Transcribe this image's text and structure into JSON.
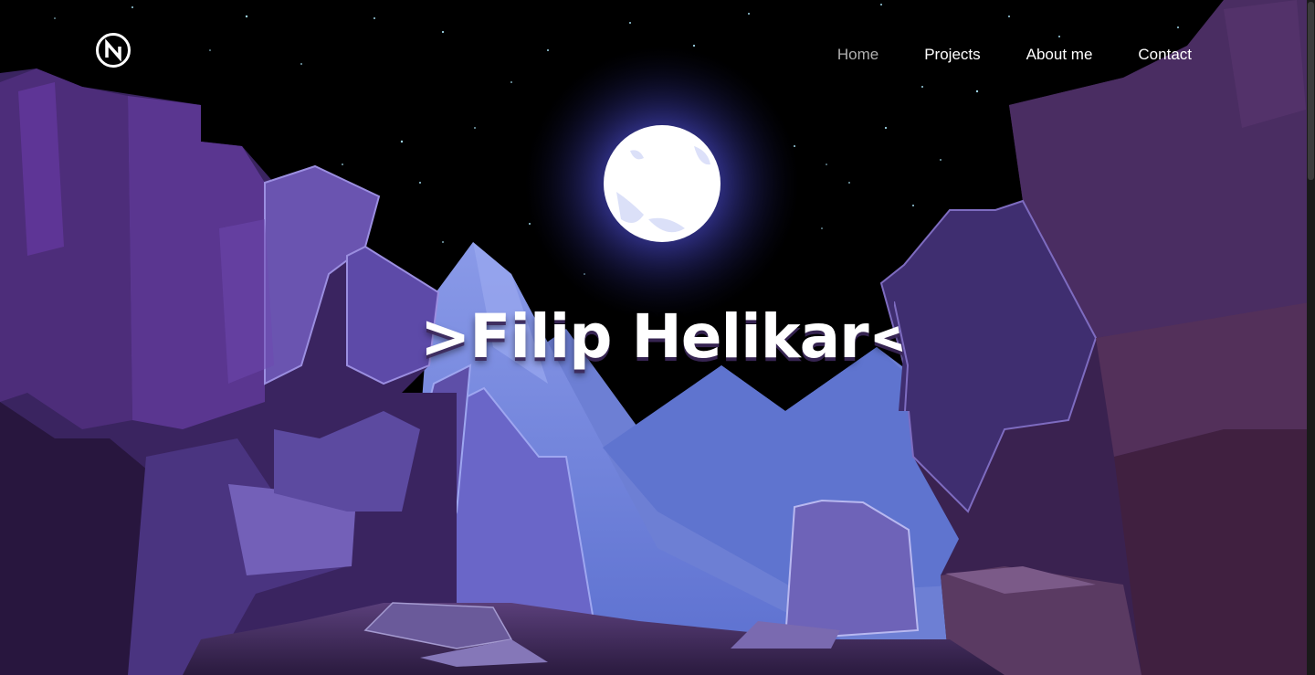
{
  "site": {
    "logo_icon": "n-logo-icon",
    "hero_title": ">Filip Helikar</:"
  },
  "nav": {
    "items": [
      {
        "label": "Home",
        "active": true
      },
      {
        "label": "Projects",
        "active": false
      },
      {
        "label": "About me",
        "active": false
      },
      {
        "label": "Contact",
        "active": false
      }
    ]
  },
  "colors": {
    "sky": "#000000",
    "moon": "#ffffff",
    "moon_glow": "#5a5ad6",
    "cliff_dark": "#2a1840",
    "cliff_mid": "#5b3a8e",
    "cliff_light": "#7a66c8",
    "mountain": "#6a7fd8",
    "nav_text": "#ffffff",
    "nav_active": "#b0b0b0"
  }
}
